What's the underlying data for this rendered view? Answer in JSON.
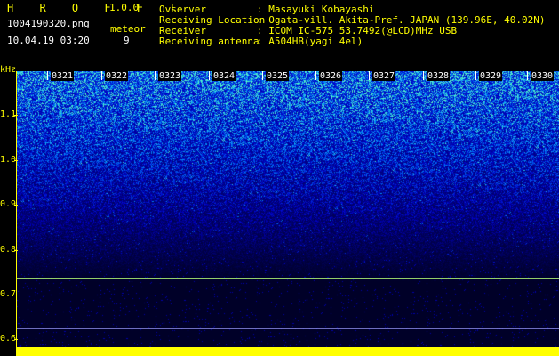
{
  "header": {
    "app_title": "H R O F F T",
    "version": "1.0.0",
    "filename": "1004190320.png",
    "timestamp": "10.04.19 03:20",
    "meteor_label": "meteor",
    "meteor_count": "9"
  },
  "info": {
    "observer_label": "Ovserver",
    "observer_value": ": Masayuki Kobayashi",
    "location_label": "Receiving Location",
    "location_value": ": Ogata-vill. Akita-Pref. JAPAN (139.96E, 40.02N)",
    "receiver_label": "Receiver",
    "receiver_value": ": ICOM IC-575 53.7492(@LCD)MHz USB",
    "antenna_label": "Receiving antenna",
    "antenna_value": ": A504HB(yagi 4el)"
  },
  "axis": {
    "unit": "kHz",
    "ticks": [
      "1.1",
      "1.0",
      "0.9",
      "0.8",
      "0.7",
      "0.6"
    ]
  },
  "columns": [
    "0321",
    "0322",
    "0323",
    "0324",
    "0325",
    "0326",
    "0327",
    "0328",
    "0329",
    "0330"
  ],
  "colors": {
    "accent": "#ffff00",
    "background": "#000000",
    "spectrum_low": "#000040",
    "spectrum_high": "#00ffb0"
  }
}
